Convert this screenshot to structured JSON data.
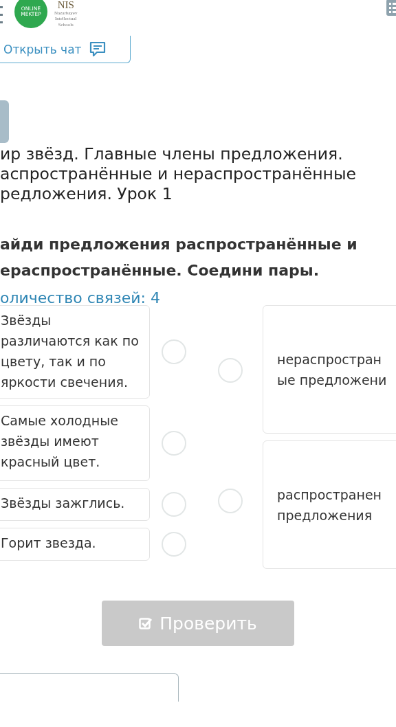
{
  "header": {
    "logo_text": [
      "ONLINE",
      "MEKTEP"
    ],
    "partner_logo": {
      "name": "NIS",
      "subtitle": [
        "Nazarbayev",
        "Intellectual",
        "Schools"
      ]
    }
  },
  "chat_button": {
    "label": "Открыть чат"
  },
  "lesson_title_lines": [
    "ир звёзд. Главные члены предложения.",
    "аспространённые и нераспространённые",
    "редложения. Урок 1"
  ],
  "task": {
    "lines": [
      "айди предложения распространённые и",
      "ераспространённые. Соедини пары."
    ]
  },
  "link_count": "оличество связей: 4",
  "left_items": [
    {
      "text": "Звёзды различаются как по цвету, так и по яркости свечения.",
      "selected": false
    },
    {
      "text": "Самые холодные звёзды имеют красный цвет.",
      "selected": false
    },
    {
      "text": "Звёзды зажглись.",
      "selected": false
    },
    {
      "text": "Горит звезда.",
      "selected": false
    }
  ],
  "right_items": [
    {
      "lines": [
        "нераспростран",
        "ые предложени"
      ],
      "selected": false
    },
    {
      "lines": [
        "распространен",
        "предложения"
      ],
      "selected": false
    }
  ],
  "check_button": {
    "label": "Проверить",
    "disabled": true
  }
}
